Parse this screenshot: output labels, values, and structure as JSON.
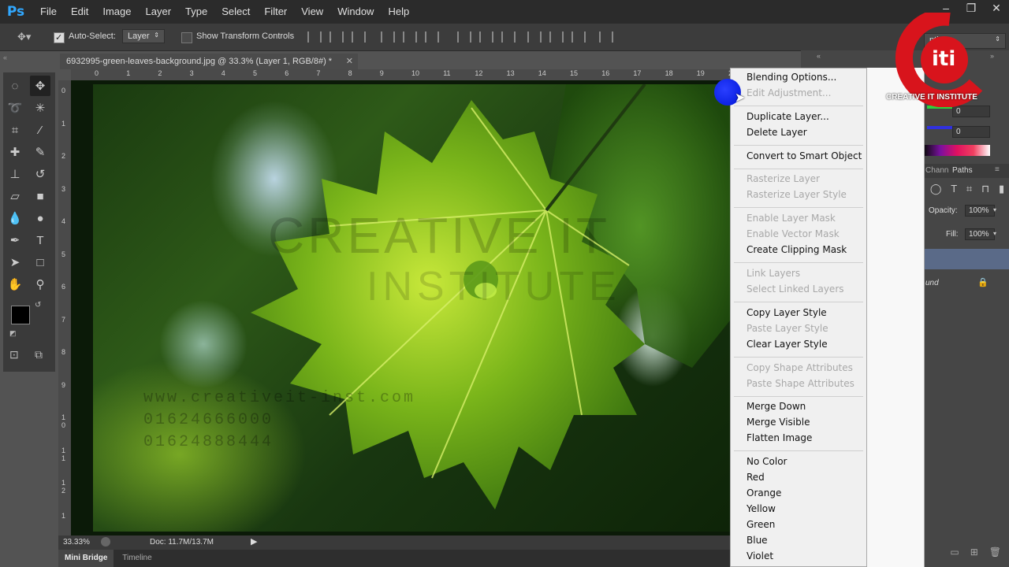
{
  "app": {
    "logo": "Ps"
  },
  "menubar": {
    "items": [
      "File",
      "Edit",
      "Image",
      "Layer",
      "Type",
      "Select",
      "Filter",
      "View",
      "Window",
      "Help"
    ],
    "window_controls": [
      "–",
      "❐",
      "✕"
    ]
  },
  "options_bar": {
    "auto_select_label": "Auto-Select:",
    "auto_select_checked": true,
    "auto_select_value": "Layer",
    "transform_label": "Show Transform Controls",
    "transform_checked": false
  },
  "document": {
    "tab_title": "6932995-green-leaves-background.jpg @ 33.3% (Layer 1, RGB/8#) *",
    "ruler_h": [
      "0",
      "1",
      "2",
      "3",
      "4",
      "5",
      "6",
      "7",
      "8",
      "9",
      "10",
      "11",
      "12",
      "13",
      "14",
      "15",
      "16",
      "17",
      "18",
      "19",
      "2"
    ],
    "ruler_v": [
      "0",
      "1",
      "2",
      "3",
      "4",
      "5",
      "6",
      "7",
      "8",
      "9",
      "1\n0",
      "1\n1",
      "1\n2",
      "1"
    ],
    "watermark_line1": "CREATIVE IT",
    "watermark_line2": "INSTITUTE",
    "watermark_url": "www.creativeit-inst.com",
    "watermark_phone1": "01624666000",
    "watermark_phone2": "01624888444"
  },
  "status_bar": {
    "zoom": "33.33%",
    "doc_info": "Doc: 11.7M/13.7M"
  },
  "bottom_tabs": [
    "Mini Bridge",
    "Timeline"
  ],
  "right_panel": {
    "workspace": "ntials",
    "side_text_gr": "Gr",
    "color_values": [
      "0",
      "0"
    ],
    "panel_tabs": [
      "Chann",
      "Paths"
    ],
    "opacity_label": "Opacity:",
    "opacity_value": "100%",
    "fill_label": "Fill:",
    "fill_value": "100%",
    "background_layer": "und"
  },
  "logo": {
    "text": "CREATIVE IT INSTITUTE",
    "mark": "iti"
  },
  "context_menu": {
    "groups": [
      [
        {
          "label": "Blending Options...",
          "enabled": true
        },
        {
          "label": "Edit Adjustment...",
          "enabled": false
        }
      ],
      [
        {
          "label": "Duplicate Layer...",
          "enabled": true
        },
        {
          "label": "Delete Layer",
          "enabled": true
        }
      ],
      [
        {
          "label": "Convert to Smart Object",
          "enabled": true
        }
      ],
      [
        {
          "label": "Rasterize Layer",
          "enabled": false
        },
        {
          "label": "Rasterize Layer Style",
          "enabled": false
        }
      ],
      [
        {
          "label": "Enable Layer Mask",
          "enabled": false
        },
        {
          "label": "Enable Vector Mask",
          "enabled": false
        },
        {
          "label": "Create Clipping Mask",
          "enabled": true
        }
      ],
      [
        {
          "label": "Link Layers",
          "enabled": false
        },
        {
          "label": "Select Linked Layers",
          "enabled": false
        }
      ],
      [
        {
          "label": "Copy Layer Style",
          "enabled": true
        },
        {
          "label": "Paste Layer Style",
          "enabled": false
        },
        {
          "label": "Clear Layer Style",
          "enabled": true
        }
      ],
      [
        {
          "label": "Copy Shape Attributes",
          "enabled": false
        },
        {
          "label": "Paste Shape Attributes",
          "enabled": false
        }
      ],
      [
        {
          "label": "Merge Down",
          "enabled": true
        },
        {
          "label": "Merge Visible",
          "enabled": true
        },
        {
          "label": "Flatten Image",
          "enabled": true
        }
      ],
      [
        {
          "label": "No Color",
          "enabled": true
        },
        {
          "label": "Red",
          "enabled": true
        },
        {
          "label": "Orange",
          "enabled": true
        },
        {
          "label": "Yellow",
          "enabled": true
        },
        {
          "label": "Green",
          "enabled": true
        },
        {
          "label": "Blue",
          "enabled": true
        },
        {
          "label": "Violet",
          "enabled": true
        }
      ]
    ]
  },
  "colors": {
    "menubar_bg": "#2b2b2b",
    "panel_bg": "#535353",
    "ps_blue": "#31a8ff",
    "logo_red": "#d8141c"
  }
}
